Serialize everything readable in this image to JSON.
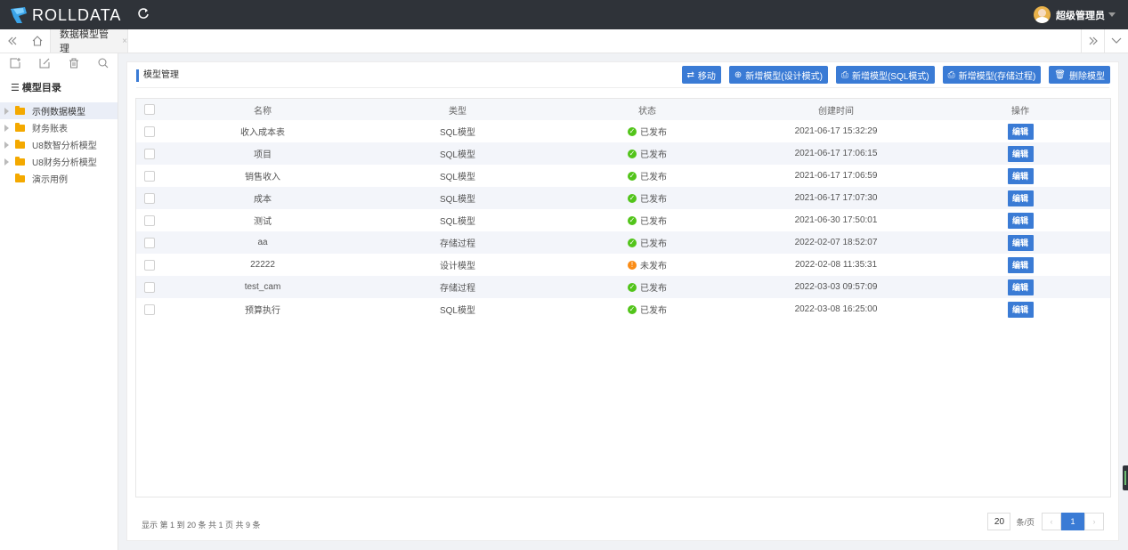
{
  "header": {
    "logo_text": "ROLLDATA",
    "logo_icon": "rolldata-logo-icon",
    "refresh_icon": "refresh-icon",
    "user_name": "超级管理员"
  },
  "tabs": {
    "active_label": "数据模型管理",
    "close_glyph": "×"
  },
  "sidebar": {
    "tools": [
      "add-icon",
      "edit-icon",
      "delete-icon",
      "search-icon"
    ],
    "title": "模型目录",
    "items": [
      {
        "label": "示例数据模型",
        "has_children": true,
        "active": true
      },
      {
        "label": "财务账表",
        "has_children": true,
        "active": false
      },
      {
        "label": "U8数智分析模型",
        "has_children": true,
        "active": false
      },
      {
        "label": "U8财务分析模型",
        "has_children": true,
        "active": false
      },
      {
        "label": "演示用例",
        "has_children": false,
        "active": false
      }
    ]
  },
  "main": {
    "title": "模型管理",
    "buttons": {
      "move": "移动",
      "add_design": "新增模型(设计模式)",
      "add_sql": "新增模型(SQL模式)",
      "add_proc": "新增模型(存储过程)",
      "delete": "删除模型"
    },
    "columns": {
      "name": "名称",
      "type": "类型",
      "status": "状态",
      "created": "创建时间",
      "action": "操作"
    },
    "rows": [
      {
        "name": "收入成本表",
        "type": "SQL模型",
        "status": "已发布",
        "published": true,
        "created": "2021-06-17 15:32:29",
        "action": "编辑"
      },
      {
        "name": "项目",
        "type": "SQL模型",
        "status": "已发布",
        "published": true,
        "created": "2021-06-17 17:06:15",
        "action": "编辑"
      },
      {
        "name": "销售收入",
        "type": "SQL模型",
        "status": "已发布",
        "published": true,
        "created": "2021-06-17 17:06:59",
        "action": "编辑"
      },
      {
        "name": "成本",
        "type": "SQL模型",
        "status": "已发布",
        "published": true,
        "created": "2021-06-17 17:07:30",
        "action": "编辑"
      },
      {
        "name": "测试",
        "type": "SQL模型",
        "status": "已发布",
        "published": true,
        "created": "2021-06-30 17:50:01",
        "action": "编辑"
      },
      {
        "name": "aa",
        "type": "存储过程",
        "status": "已发布",
        "published": true,
        "created": "2022-02-07 18:52:07",
        "action": "编辑"
      },
      {
        "name": "22222",
        "type": "设计模型",
        "status": "未发布",
        "published": false,
        "created": "2022-02-08 11:35:31",
        "action": "编辑"
      },
      {
        "name": "test_cam",
        "type": "存储过程",
        "status": "已发布",
        "published": true,
        "created": "2022-03-03 09:57:09",
        "action": "编辑"
      },
      {
        "name": "预算执行",
        "type": "SQL模型",
        "status": "已发布",
        "published": true,
        "created": "2022-03-08 16:25:00",
        "action": "编辑"
      }
    ],
    "footer_info": "显示 第 1 到 20 条 共 1 页 共 9 条",
    "pager": {
      "page_size": "20",
      "unit": "条/页",
      "prev": "‹",
      "current": "1",
      "next": "›"
    }
  },
  "colors": {
    "primary": "#3a7bd5",
    "header_bg": "#2f3339",
    "published": "#52c41a",
    "unpublished": "#fa8c16"
  }
}
